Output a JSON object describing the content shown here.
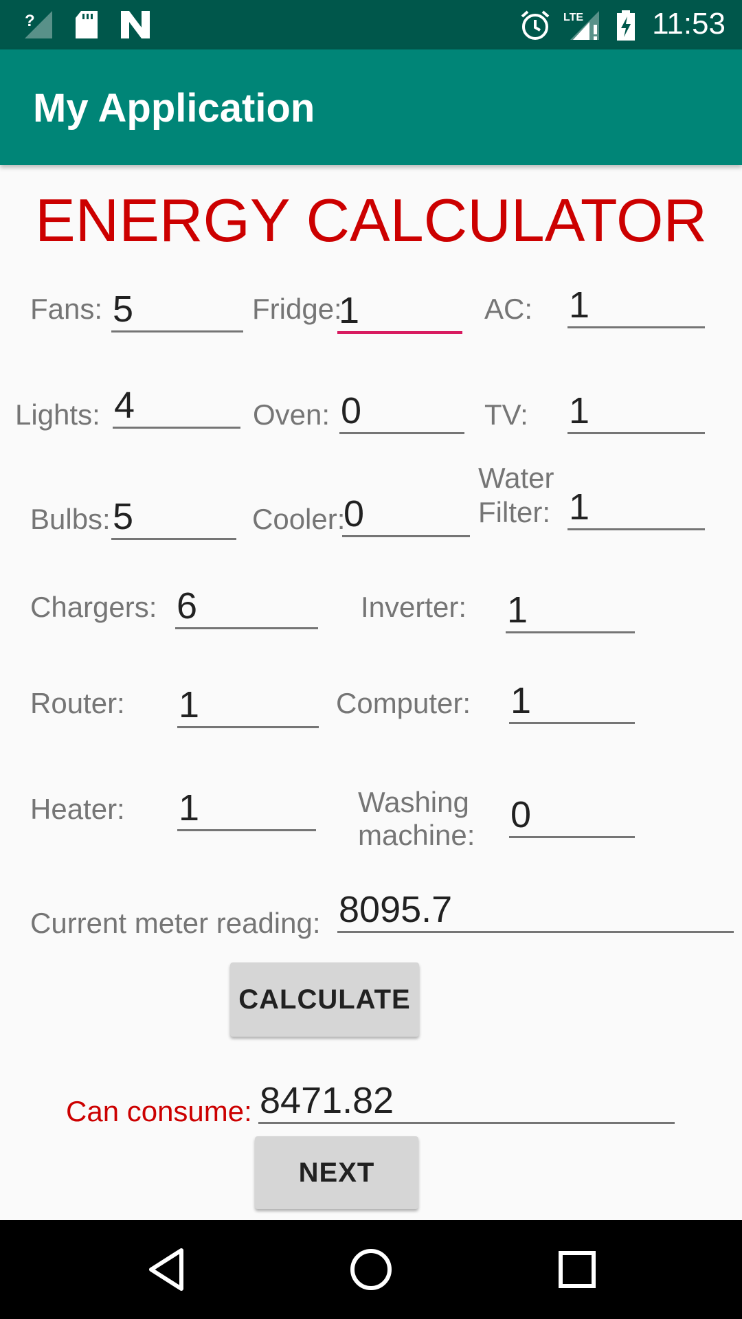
{
  "status_bar": {
    "time": "11:53",
    "icons": [
      "signal-unknown-icon",
      "sd-card-icon",
      "n-logo-icon",
      "alarm-icon",
      "lte-signal-icon",
      "battery-charging-icon"
    ],
    "lte_label": "LTE"
  },
  "app_bar": {
    "title": "My Application"
  },
  "heading": "ENERGY CALCULATOR",
  "fields": {
    "fans": {
      "label": "Fans:",
      "value": "5"
    },
    "fridge": {
      "label": "Fridge:",
      "value": "1"
    },
    "ac": {
      "label": "AC:",
      "value": "1"
    },
    "lights": {
      "label": "Lights:",
      "value": "4"
    },
    "oven": {
      "label": "Oven:",
      "value": "0"
    },
    "tv": {
      "label": "TV:",
      "value": "1"
    },
    "bulbs": {
      "label": "Bulbs:",
      "value": "5"
    },
    "cooler": {
      "label": "Cooler:",
      "value": "0"
    },
    "water_filter": {
      "label_line1": "Water",
      "label_line2": "Filter:",
      "value": "1"
    },
    "chargers": {
      "label": "Chargers:",
      "value": "6"
    },
    "inverter": {
      "label": "Inverter:",
      "value": "1"
    },
    "router": {
      "label": "Router:",
      "value": "1"
    },
    "computer": {
      "label": "Computer:",
      "value": "1"
    },
    "heater": {
      "label": "Heater:",
      "value": "1"
    },
    "washing_machine": {
      "label_line1": "Washing",
      "label_line2": "machine:",
      "value": "0"
    },
    "meter_reading": {
      "label": "Current meter reading:",
      "value": "8095.7"
    },
    "can_consume": {
      "label": "Can consume:",
      "value": "8471.82"
    }
  },
  "buttons": {
    "calculate": "CALCULATE",
    "next": "NEXT"
  },
  "colors": {
    "status_bar": "#00574b",
    "app_bar": "#008577",
    "accent": "#d81b60",
    "heading_red": "#cc0000"
  },
  "nav_bar": {
    "icons": [
      "back-icon",
      "home-icon",
      "recents-icon"
    ]
  }
}
